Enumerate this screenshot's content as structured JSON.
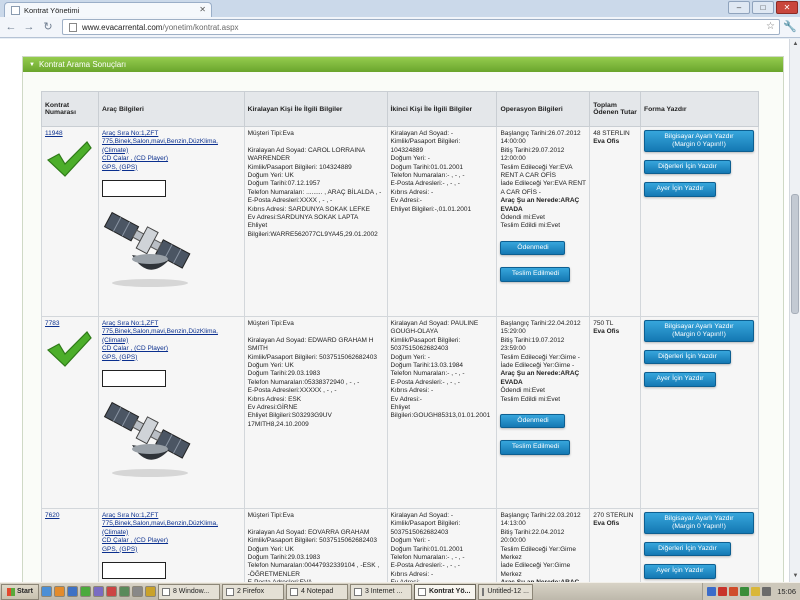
{
  "browser": {
    "tab_title": "Kontrat Yönetimi",
    "url_host": "www.evacarrental.com",
    "url_path": "/yonetim/kontrat.aspx"
  },
  "panel": {
    "title": "Kontrat Arama Sonuçları"
  },
  "table": {
    "headers": {
      "id": "Kontrat Numarası",
      "vehicle": "Araç Bilgileri",
      "tenant": "Kiralayan Kişi İle İlgili Bilgiler",
      "second": "İkinci Kişi İle İlgili Bilgiler",
      "ops": "Operasyon Bilgileri",
      "total": "Toplam Ödenen Tutar",
      "print": "Forma Yazdır"
    },
    "rows": [
      {
        "id": "11948",
        "vehicle": [
          "Araç Sıra No:1,ZFT",
          "775,Binek,Salon,mavi,Benzin,DüzKlima,",
          "(Climate)",
          "CD Çalar , (CD Player)",
          "GPS, (GPS)"
        ],
        "tenant": [
          "Müşteri Tipi:Eva",
          "",
          "Kiralayan Ad Soyad: CAROL LORRAINA",
          "WARRENDER",
          "Kimlik/Pasaport Bilgileri: 104324889",
          "Doğum Yeri: UK",
          "Doğum Tarihi:07.12.1957",
          "Telefon Numaraları: ......... , ARAÇ BİLALDA , -",
          "E-Posta Adresleri:XXXX , - , -",
          "Kıbrıs Adresi: SARDUNYA SOKAK LEFKE",
          "Ev Adresi:SARDUNYA SOKAK LAPTA",
          "Ehliyet",
          "Bilgileri:WARRE562077CL9YA45,29.01.2002"
        ],
        "second": [
          "Kiralayan Ad Soyad: -",
          "Kimlik/Pasaport Bilgileri:",
          "104324889",
          "Doğum Yeri: -",
          "Doğum Tarihi:01.01.2001",
          "Telefon Numaraları:- , - , -",
          "E-Posta Adresleri:- , - , -",
          "Kıbrıs Adresi: -",
          "Ev Adresi:-",
          "Ehliyet Bilgileri:-,01.01.2001"
        ],
        "ops": [
          "Başlangıç Tarihi:26.07.2012",
          "14:00:00",
          "Bitiş Tarihi:29.07.2012",
          "12:00:00",
          "Teslim Edileceği Yer:EVA",
          "RENT A CAR OFİS",
          "İade Edileceği Yer:EVA RENT",
          "A CAR OFİS -"
        ],
        "ops_bold": "Araç Şu an Nerede:ARAÇ EVADA",
        "ops_tail": [
          "Ödendi mi:Evet",
          "Teslim Edildi mi:Evet"
        ],
        "total_amount": "48 STERLIN",
        "total_place": "Eva Ofis"
      },
      {
        "id": "7783",
        "vehicle": [
          "Araç Sıra No:1,ZFT",
          "775,Binek,Salon,mavi,Benzin,DüzKlima,",
          "(Climate)",
          "CD Çalar , (CD Player)",
          "GPS, (GPS)"
        ],
        "tenant": [
          "Müşteri Tipi:Eva",
          "",
          "Kiralayan Ad Soyad: EDWARD GRAHAM H",
          "SMITH",
          "Kimlik/Pasaport Bilgileri: 5037515062682403",
          "Doğum Yeri: UK",
          "Doğum Tarihi:29.03.1983",
          "Telefon Numaraları:05338372940 , - , -",
          "E-Posta Adresleri:XXXXX , - , -",
          "Kıbrıs Adresi: ESK",
          "Ev Adresi:GİRNE",
          "Ehliyet Bilgileri:S03293G9UV",
          "17MITH8,24.10.2009"
        ],
        "second": [
          "Kiralayan Ad Soyad: PAULINE",
          "GOUGH-OLAYA",
          "Kimlik/Pasaport Bilgileri:",
          "5037515062682403",
          "Doğum Yeri: -",
          "Doğum Tarihi:13.03.1984",
          "Telefon Numaraları:- , - , -",
          "E-Posta Adresleri:- , - , -",
          "Kıbrıs Adresi: -",
          "Ev Adresi:-",
          "Ehliyet",
          "Bilgileri:GOUGH85313,01.01.2001"
        ],
        "ops": [
          "Başlangıç Tarihi:22.04.2012",
          "15:29:00",
          "Bitiş Tarihi:19.07.2012",
          "23:59:00",
          "Teslim Edileceği Yer:Girne -",
          "İade Edileceği Yer:Girne -"
        ],
        "ops_bold": "Araç Şu an Nerede:ARAÇ EVADA",
        "ops_tail": [
          "Ödendi mi:Evet",
          "Teslim Edildi mi:Evet"
        ],
        "total_amount": "750 TL",
        "total_place": "Eva Ofis"
      },
      {
        "id": "7620",
        "vehicle": [
          "Araç Sıra No:1,ZFT",
          "775,Binek,Salon,mavi,Benzin,DüzKlima,",
          "(Climate)",
          "CD Çalar , (CD Player)",
          "GPS, (GPS)"
        ],
        "tenant": [
          "Müşteri Tipi:Eva",
          "",
          "Kiralayan Ad Soyad: EOVARRA GRAHAM",
          "Kimlik/Pasaport Bilgileri: 5037515062682403",
          "Doğum Yeri: UK",
          "Doğum Tarihi:29.03.1983",
          "Telefon Numaraları:00447932339104 , -ESK , -ÖĞRETMENLER",
          "E-Posta Adresleri:EVA"
        ],
        "second": [
          "Kiralayan Ad Soyad: -",
          "Kimlik/Pasaport Bilgileri:",
          "5037515062682403",
          "Doğum Yeri: -",
          "Doğum Tarihi:01.01.2001",
          "Telefon Numaraları:- , - , -",
          "E-Posta Adresleri:- , - , -",
          "Kıbrıs Adresi: -",
          "Ev Adresi:-"
        ],
        "ops": [
          "Başlangıç Tarihi:22.03.2012",
          "14:13:00",
          "Bitiş Tarihi:22.04.2012",
          "20:00:00",
          "Teslim Edileceği Yer:Girne",
          "Merkez",
          "İade Edileceği Yer:Girne",
          "Merkez"
        ],
        "ops_bold": "Araç Şu an Nerede:ARAÇ",
        "ops_tail": [],
        "total_amount": "270 STERLIN",
        "total_place": "Eva Ofis"
      }
    ],
    "buttons": {
      "print_pc_line1": "Bilgisayar Ayarlı Yazdır",
      "print_pc_line2": "(Margin 0 Yapın!!)",
      "print_others": "Diğerleri İçin Yazdır",
      "print_ayer": "Ayer İçin Yazdır",
      "not_paid": "Ödenmedi",
      "not_delivered": "Teslim Edilmedi"
    }
  },
  "taskbar": {
    "start": "Start",
    "tasks": [
      "8 Window...",
      "2 Firefox",
      "4 Notepad",
      "3 Internet ...",
      "Kontrat Yö...",
      "Untitled-12 ..."
    ],
    "clock": "15:06"
  },
  "colors": {
    "panel_green": "#7db83b",
    "button_blue": "#1e88c7",
    "link": "#0a2f8e"
  }
}
